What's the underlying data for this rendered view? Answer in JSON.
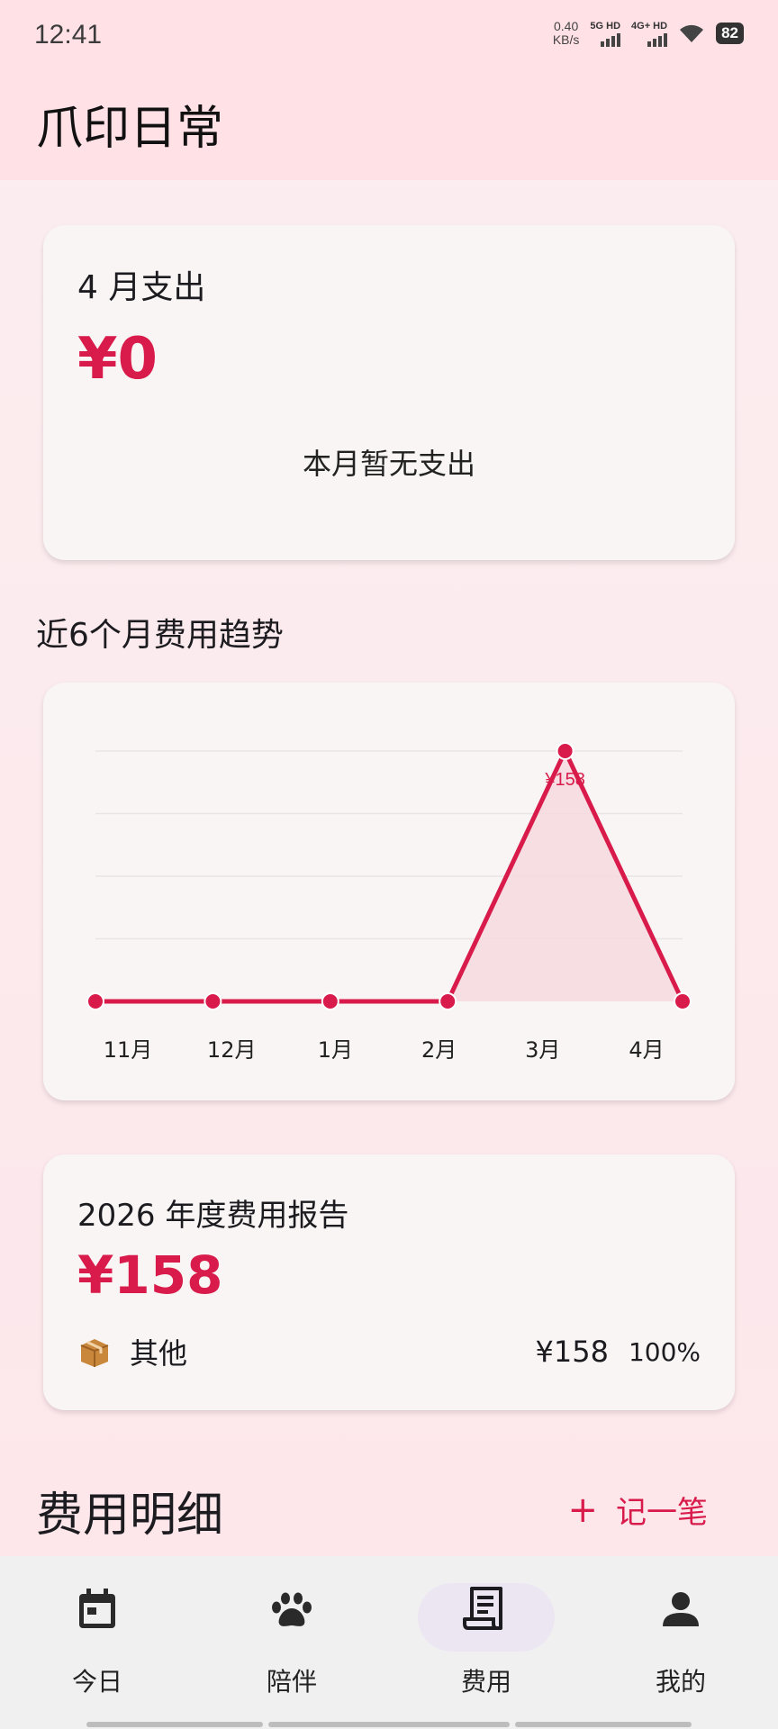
{
  "status_bar": {
    "time": "12:41",
    "net_speed_value": "0.40",
    "net_speed_unit": "KB/s",
    "sim1": "5G HD",
    "sim2": "4G+ HD",
    "battery": "82"
  },
  "app": {
    "title": "爪印日常"
  },
  "monthly": {
    "label": "4 月支出",
    "amount": "¥0",
    "empty_text": "本月暂无支出"
  },
  "trend": {
    "title": "近6个月费用趋势"
  },
  "chart_data": {
    "type": "area",
    "categories": [
      "11月",
      "12月",
      "1月",
      "2月",
      "3月",
      "4月"
    ],
    "values": [
      0,
      0,
      0,
      0,
      158,
      0
    ],
    "data_labels": [
      null,
      null,
      null,
      null,
      "¥158",
      null
    ],
    "ylim": [
      0,
      158
    ],
    "grid": true,
    "colors": {
      "line": "#d81b4a",
      "fill": "#f6d9df"
    }
  },
  "annual": {
    "label": "2026 年度费用报告",
    "amount": "¥158",
    "categories": [
      {
        "icon": "package-icon",
        "name": "其他",
        "amount": "¥158",
        "percent": "100%"
      }
    ]
  },
  "details": {
    "title": "费用明细",
    "add_plus": "+",
    "add_label": "记一笔"
  },
  "bottom_nav": {
    "items": [
      {
        "label": "今日",
        "icon": "calendar-icon",
        "active": false
      },
      {
        "label": "陪伴",
        "icon": "paw-icon",
        "active": false
      },
      {
        "label": "费用",
        "icon": "receipt-icon",
        "active": true
      },
      {
        "label": "我的",
        "icon": "person-icon",
        "active": false
      }
    ]
  },
  "colors": {
    "accent": "#d81b4a",
    "header_bg": "#ffe1e6",
    "card_bg": "#f8f5f4",
    "nav_active_pill": "#ece6f2"
  }
}
